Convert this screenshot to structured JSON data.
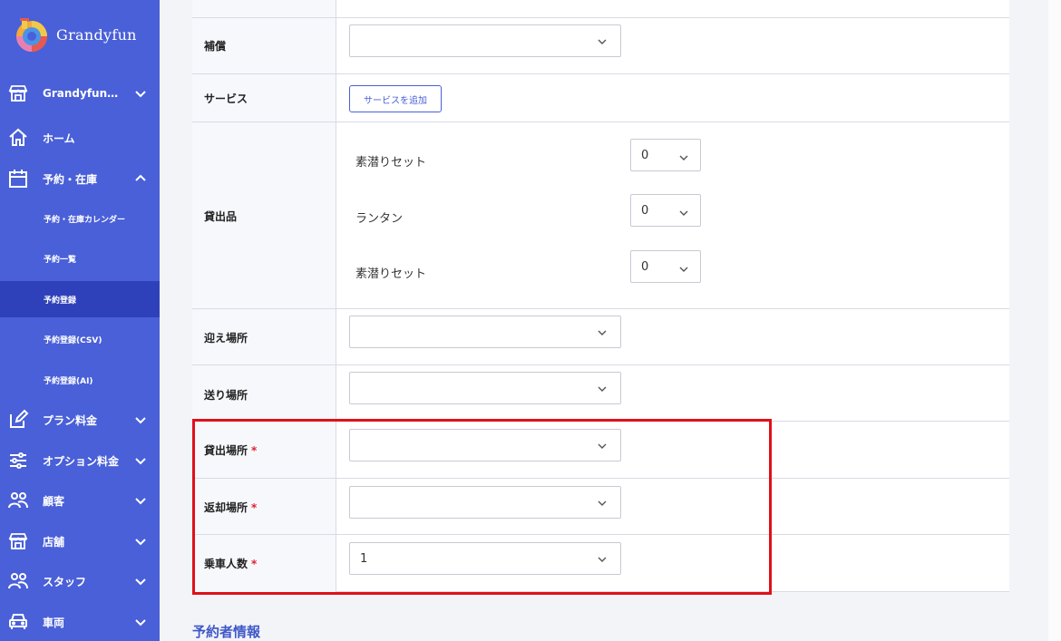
{
  "brand": {
    "name": "Grandyfun"
  },
  "sidebar": {
    "items": [
      {
        "label": "Grandyfun…"
      },
      {
        "label": "ホーム"
      },
      {
        "label": "予約・在庫"
      },
      {
        "label": "予約・在庫カレンダー"
      },
      {
        "label": "予約一覧"
      },
      {
        "label": "予約登録"
      },
      {
        "label": "予約登録(CSV)"
      },
      {
        "label": "予約登録(AI)"
      },
      {
        "label": "プラン料金"
      },
      {
        "label": "オプション料金"
      },
      {
        "label": "顧客"
      },
      {
        "label": "店舗"
      },
      {
        "label": "スタッフ"
      },
      {
        "label": "車両"
      }
    ]
  },
  "form": {
    "compensation": {
      "label": "補償",
      "value": ""
    },
    "service": {
      "label": "サービス",
      "button": "サービスを追加"
    },
    "rentals": {
      "label": "貸出品",
      "items": [
        {
          "name": "素潜りセット",
          "qty": "0"
        },
        {
          "name": "ランタン",
          "qty": "0"
        },
        {
          "name": "素潜りセット",
          "qty": "0"
        }
      ]
    },
    "pickup": {
      "label": "迎え場所",
      "value": ""
    },
    "dropoff": {
      "label": "送り場所",
      "value": ""
    },
    "rental_place": {
      "label": "貸出場所",
      "required": "*",
      "value": ""
    },
    "return_place": {
      "label": "返却場所",
      "required": "*",
      "value": ""
    },
    "passengers": {
      "label": "乗車人数",
      "required": "*",
      "value": "1"
    }
  },
  "section": {
    "booker_info": "予約者情報"
  },
  "colors": {
    "sidebar": "#4a60d8",
    "active": "#2f41ba",
    "accent": "#3e57c8",
    "highlight": "#e0101a",
    "required": "#e0212f"
  }
}
